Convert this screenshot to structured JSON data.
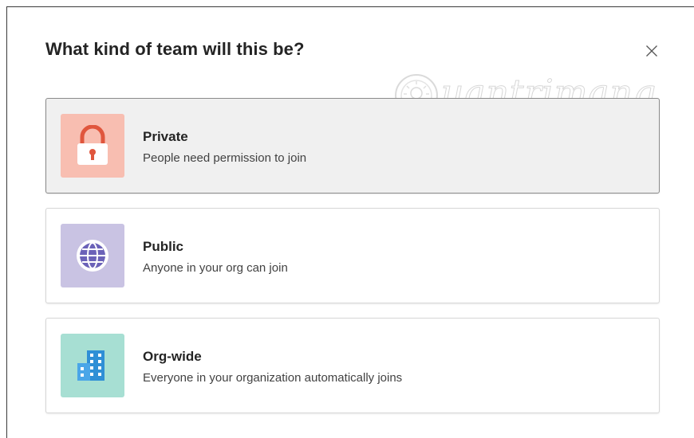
{
  "dialog": {
    "title": "What kind of team will this be?"
  },
  "watermark": {
    "text": "uantrimang"
  },
  "options": [
    {
      "title": "Private",
      "description": "People need permission to join",
      "icon": "lock-icon",
      "icon_bg": "#f8beb1",
      "icon_color": "#e0563d",
      "selected": true
    },
    {
      "title": "Public",
      "description": "Anyone in your org can join",
      "icon": "globe-icon",
      "icon_bg": "#c9c3e3",
      "icon_color": "#6b62b8",
      "selected": false
    },
    {
      "title": "Org-wide",
      "description": "Everyone in your organization automatically joins",
      "icon": "building-icon",
      "icon_bg": "#a7dfd3",
      "icon_color": "#2f8fd6",
      "selected": false
    }
  ]
}
